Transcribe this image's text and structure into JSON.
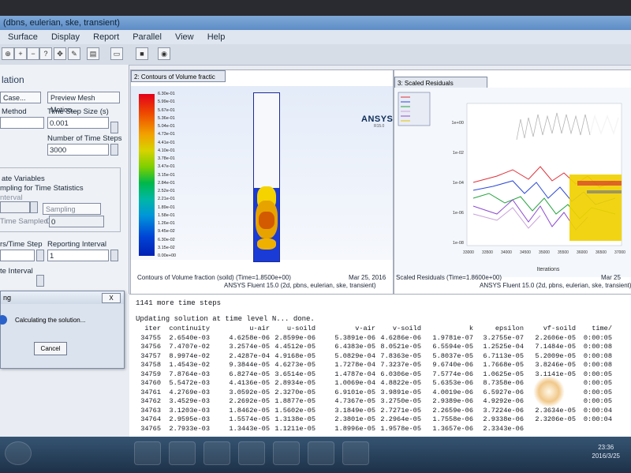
{
  "window": {
    "title": "(dbns, eulerian, ske, transient)"
  },
  "menu": [
    "Surface",
    "Display",
    "Report",
    "Parallel",
    "View",
    "Help"
  ],
  "left_panel": {
    "title": "lation",
    "case_button": "Case...",
    "mesh_motion_button": "Preview Mesh Motion...",
    "method_label": "Method",
    "time_step_size_label": "Time Step Size (s)",
    "time_step_size_value": "0.001",
    "num_time_steps_label": "Number of Time Steps",
    "num_time_steps_value": "3000",
    "data_sampling_label": "ate Variables",
    "sampling_label": "mpling for Time Statistics",
    "interval_label": "nterval",
    "sampling_options_button": "Sampling Options...",
    "time_sampled_label": "Time Sampled (s)",
    "time_sampled_value": "0",
    "per_time_step_label": "rs/Time Step",
    "reporting_interval_label": "Reporting Interval",
    "reporting_interval_value": "1",
    "profile_interval_label": "te Interval"
  },
  "graphics1": {
    "tab": "2: Contours of Volume fractic",
    "brand": "ANSYS",
    "version": "R15.0",
    "colorbar_ticks": [
      "6.30e-01",
      "5.99e-01",
      "5.67e-01",
      "5.36e-01",
      "5.04e-01",
      "4.73e-01",
      "4.41e-01",
      "4.10e-01",
      "3.78e-01",
      "3.47e-01",
      "3.15e-01",
      "2.84e-01",
      "2.52e-01",
      "2.21e-01",
      "1.89e-01",
      "1.58e-01",
      "1.26e-01",
      "9.45e-02",
      "6.30e-02",
      "3.15e-02",
      "0.00e+00"
    ],
    "caption": "Contours of Volume fraction (soild)  (Time=1.8500e+00)",
    "date": "Mar 25, 2016",
    "footer": "ANSYS Fluent 15.0 (2d, pbns, eulerian, ske, transient)"
  },
  "graphics2": {
    "tab": "3: Scaled Residuals",
    "y_ticks": [
      "1e+00",
      "1e-02",
      "1e-04",
      "1e-06",
      "1e-08"
    ],
    "x_ticks": [
      "33000",
      "33500",
      "34000",
      "34500",
      "35000",
      "35500",
      "36000",
      "36500",
      "37000"
    ],
    "x_label": "Iterations",
    "caption": "Scaled Residuals  (Time=1.8600e+00)",
    "date": "Mar 25",
    "footer": "ANSYS Fluent 15.0 (2d, pbns, eulerian, ske, transient)"
  },
  "console": {
    "line1": "1141 more time steps",
    "line2": "Updating solution at time level N... done.",
    "headers": [
      "iter",
      "continuity",
      "u-air",
      "u-soild",
      "v-air",
      "v-soild",
      "k",
      "epsilon",
      "vf-soild",
      "time/"
    ],
    "rows": [
      [
        "34755",
        "2.6540e-03",
        "4.6258e-06",
        "2.8599e-06",
        "5.3891e-06",
        "4.6286e-06",
        "1.9781e-07",
        "3.2755e-07",
        "2.2606e-05",
        "0:00:05"
      ],
      [
        "34756",
        "7.4707e-02",
        "3.2574e-05",
        "4.4512e-05",
        "6.4383e-05",
        "8.0521e-05",
        "6.5594e-05",
        "1.2525e-04",
        "7.1484e-05",
        "0:00:08"
      ],
      [
        "34757",
        "8.9974e-02",
        "2.4287e-04",
        "4.9168e-05",
        "5.0829e-04",
        "7.8363e-05",
        "5.8037e-05",
        "6.7113e-05",
        "5.2009e-05",
        "0:00:08"
      ],
      [
        "34758",
        "1.4543e-02",
        "9.3844e-05",
        "4.6273e-05",
        "1.7278e-04",
        "7.3237e-05",
        "9.6740e-06",
        "1.7668e-05",
        "3.8246e-05",
        "0:00:08"
      ],
      [
        "34759",
        "7.8764e-03",
        "6.8274e-05",
        "3.6514e-05",
        "1.4787e-04",
        "6.0306e-05",
        "7.5774e-06",
        "1.0625e-05",
        "3.1141e-05",
        "0:00:05"
      ],
      [
        "34760",
        "5.5472e-03",
        "4.4136e-05",
        "2.8934e-05",
        "1.0069e-04",
        "4.8822e-05",
        "5.6353e-06",
        "8.7358e-06",
        "",
        "0:00:05"
      ],
      [
        "34761",
        "4.2769e-03",
        "3.0592e-05",
        "2.3270e-05",
        "6.9101e-05",
        "3.9891e-05",
        "4.0019e-06",
        "6.5927e-06",
        "",
        "0:00:05"
      ],
      [
        "34762",
        "3.4529e-03",
        "2.2692e-05",
        "1.8877e-05",
        "4.7367e-05",
        "3.2750e-05",
        "2.9389e-06",
        "4.9292e-06",
        "",
        "0:00:05"
      ],
      [
        "34763",
        "3.1203e-03",
        "1.8462e-05",
        "1.5602e-05",
        "3.1849e-05",
        "2.7271e-05",
        "2.2659e-06",
        "3.7224e-06",
        "2.3634e-05",
        "0:00:04"
      ],
      [
        "34764",
        "2.9595e-03",
        "1.5574e-05",
        "1.3138e-05",
        "2.3801e-05",
        "2.2964e-05",
        "1.7558e-06",
        "2.9338e-06",
        "2.3206e-05",
        "0:00:04"
      ],
      [
        "34765",
        "2.7933e-03",
        "1.3443e-05",
        "1.1211e-05",
        "1.8996e-05",
        "1.9578e-05",
        "1.3657e-06",
        "2.3343e-06",
        "",
        ""
      ]
    ]
  },
  "dialog": {
    "title": "ng",
    "close": "X",
    "message": "Calculating the solution...",
    "cancel": "Cancel"
  },
  "taskbar": {
    "clock_time": "23:36",
    "clock_date": "2016/3/25"
  }
}
